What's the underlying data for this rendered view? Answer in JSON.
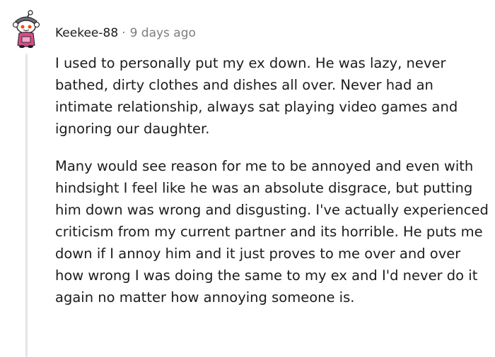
{
  "comment": {
    "username": "Keekee-88",
    "separator": "·",
    "timestamp": "9 days ago",
    "avatar_icon": "snoo-avatar-icon",
    "paragraphs": [
      "I used to personally put my ex down. He was lazy, never bathed, dirty clothes and dishes all over. Never had an intimate relationship, always sat playing video games and ignoring our daughter.",
      "Many would see reason for me to be annoyed and even with hindsight I feel like he was an absolute disgrace, but putting him down was wrong and disgusting. I've actually experienced criticism from my current partner and its horrible. He puts me down if I annoy him and it just proves to me over and over how wrong I was doing the same to my ex and I'd never do it again no matter how annoying someone is."
    ]
  },
  "colors": {
    "text": "#1c1c1c",
    "muted": "#7c7c7c",
    "thread_line": "#e5e6e8",
    "background": "#ffffff"
  }
}
